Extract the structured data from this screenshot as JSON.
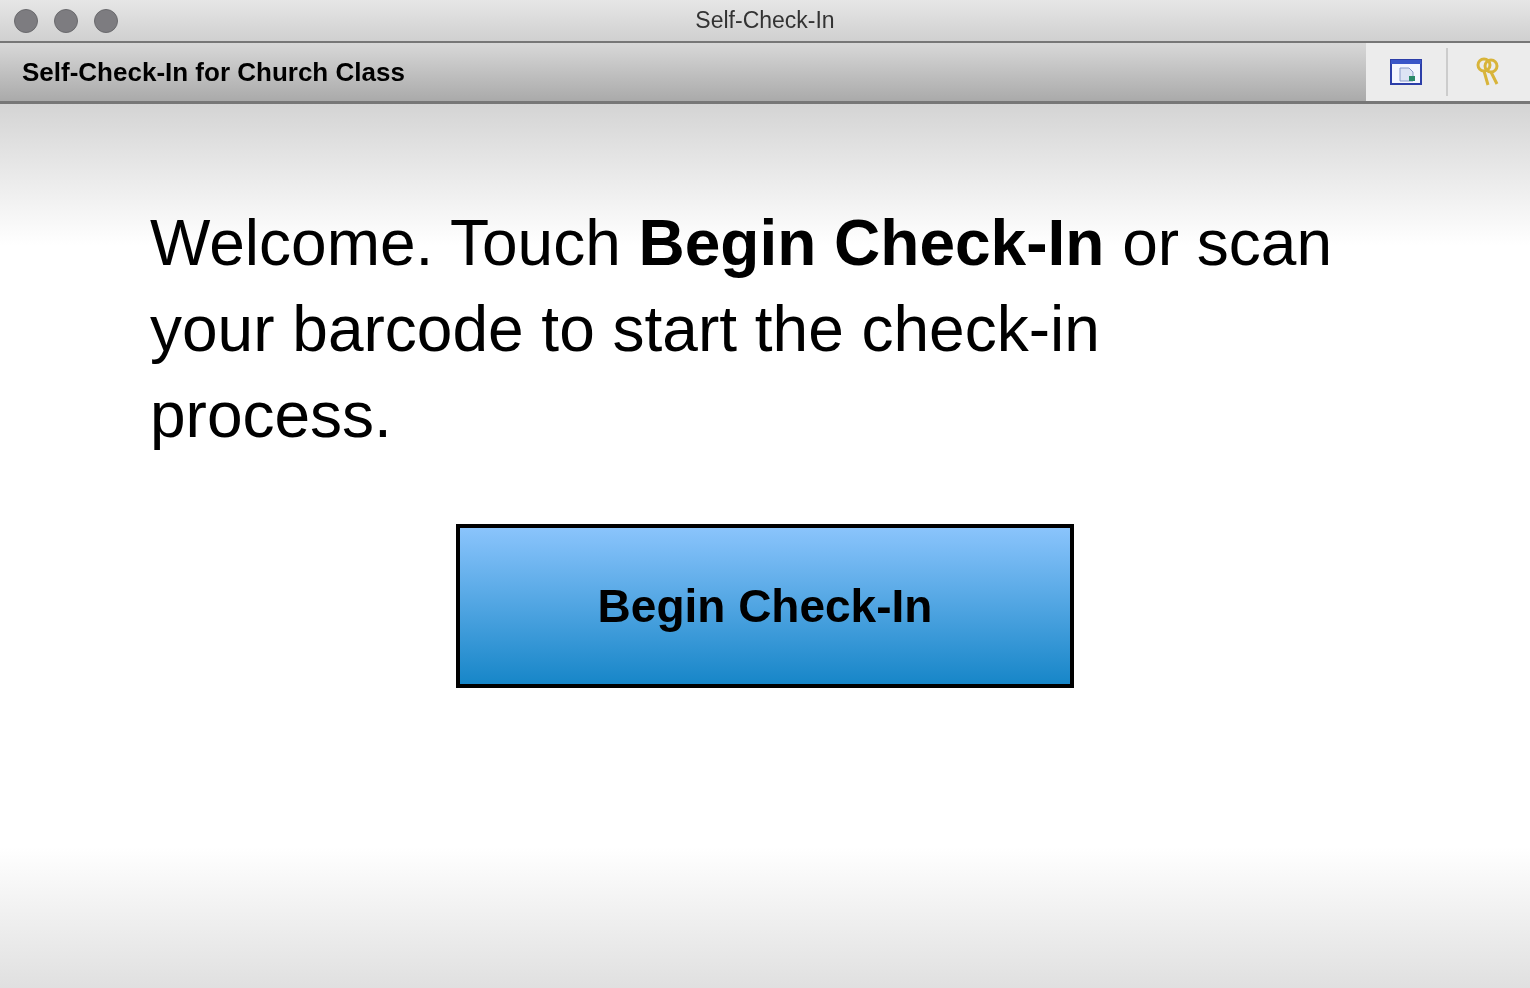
{
  "window": {
    "title": "Self-Check-In"
  },
  "header": {
    "title": "Self-Check-In for Church Class"
  },
  "welcome": {
    "message": "Welcome. Touch **Begin Check-In** or scan your barcode to start the check-in process."
  },
  "primary_button": {
    "label": "Begin Check-In"
  }
}
